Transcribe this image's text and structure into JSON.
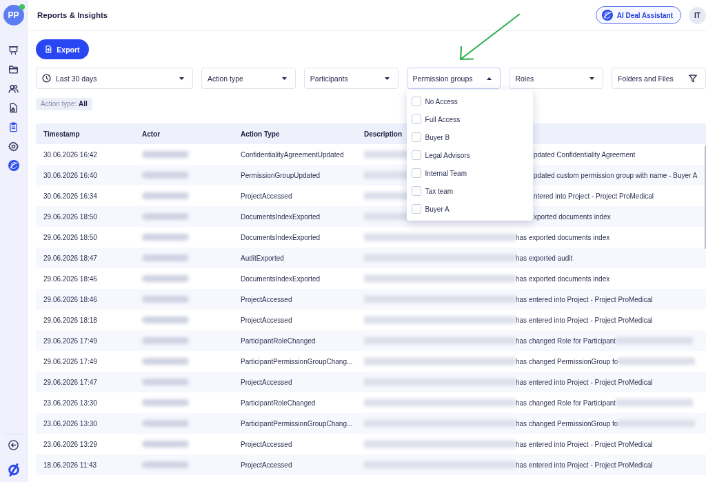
{
  "sidebar": {
    "avatar": {
      "initials": "PP",
      "online": true
    },
    "items": [
      {
        "selected": false
      },
      {
        "selected": false
      },
      {
        "selected": false
      },
      {
        "selected": false
      },
      {
        "selected": true
      },
      {
        "selected": false
      }
    ]
  },
  "header": {
    "title": "Reports & Insights",
    "assistant_button": "AI Deal Assistant",
    "user_initials": "IT"
  },
  "toolbar": {
    "export_button": "Export"
  },
  "filters": [
    {
      "kind": "date",
      "label": "Last 30 days",
      "expanded": false
    },
    {
      "kind": "select",
      "label": "Action type",
      "expanded": false
    },
    {
      "kind": "select",
      "label": "Participants",
      "expanded": false
    },
    {
      "kind": "select",
      "label": "Permission groups",
      "expanded": true,
      "options": [
        {
          "label": "No Access",
          "checked": false
        },
        {
          "label": "Full Access",
          "checked": false
        },
        {
          "label": "Buyer B",
          "checked": false
        },
        {
          "label": "Legal Advisors",
          "checked": false
        },
        {
          "label": "Internal Team",
          "checked": false
        },
        {
          "label": "Tax team",
          "checked": false
        },
        {
          "label": "Buyer A",
          "checked": false
        }
      ]
    },
    {
      "kind": "select",
      "label": "Roles",
      "expanded": false
    },
    {
      "kind": "filter",
      "label": "Folders and Files",
      "expanded": false
    }
  ],
  "active_filters": [
    {
      "text": "Action type: **All**"
    }
  ],
  "table": {
    "columns": [
      "Timestamp",
      "Actor",
      "Action Type",
      "Description"
    ],
    "rows": [
      {
        "timestamp": "30.06.2026 16:42",
        "actor": {
          "redacted": true
        },
        "action_type": "ConfidentialityAgreementUpdated",
        "description": [
          {
            "kind": "redacted"
          },
          {
            "kind": "text",
            "text": "pdated Confidentiality Agreement"
          }
        ]
      },
      {
        "timestamp": "30.06.2026 16:40",
        "actor": {
          "redacted": true
        },
        "action_type": "PermissionGroupUpdated",
        "description": [
          {
            "kind": "redacted"
          },
          {
            "kind": "text",
            "text": "pdated custom permission group with name - Buyer A"
          }
        ]
      },
      {
        "timestamp": "30.06.2026 16:34",
        "actor": {
          "redacted": true
        },
        "action_type": "ProjectAccessed",
        "description": [
          {
            "kind": "redacted"
          },
          {
            "kind": "text",
            "text": "ntered into Project - Project ProMedical"
          }
        ]
      },
      {
        "timestamp": "29.06.2026 18:50",
        "actor": {
          "redacted": true
        },
        "action_type": "DocumentsIndexExported",
        "description": [
          {
            "kind": "redacted"
          },
          {
            "kind": "text",
            "text": "xported documents index"
          }
        ]
      },
      {
        "timestamp": "29.06.2026 18:50",
        "actor": {
          "redacted": true
        },
        "action_type": "DocumentsIndexExported",
        "description": [
          {
            "kind": "redacted"
          },
          {
            "kind": "text",
            "text": "has exported documents index"
          }
        ]
      },
      {
        "timestamp": "29.06.2026 18:47",
        "actor": {
          "redacted": true
        },
        "action_type": "AuditExported",
        "description": [
          {
            "kind": "redacted"
          },
          {
            "kind": "text",
            "text": "has exported audit"
          }
        ]
      },
      {
        "timestamp": "29.06.2026 18:46",
        "actor": {
          "redacted": true
        },
        "action_type": "DocumentsIndexExported",
        "description": [
          {
            "kind": "redacted"
          },
          {
            "kind": "text",
            "text": "has exported documents index"
          }
        ]
      },
      {
        "timestamp": "29.06.2026 18:46",
        "actor": {
          "redacted": true
        },
        "action_type": "ProjectAccessed",
        "description": [
          {
            "kind": "redacted"
          },
          {
            "kind": "text",
            "text": "has entered into Project - Project ProMedical"
          }
        ]
      },
      {
        "timestamp": "29.06.2026 18:18",
        "actor": {
          "redacted": true
        },
        "action_type": "ProjectAccessed",
        "description": [
          {
            "kind": "redacted"
          },
          {
            "kind": "text",
            "text": "has entered into Project - Project ProMedical"
          }
        ]
      },
      {
        "timestamp": "29.06.2026 17:49",
        "actor": {
          "redacted": true
        },
        "action_type": "ParticipantRoleChanged",
        "description": [
          {
            "kind": "redacted"
          },
          {
            "kind": "text",
            "text": "has changed Role for Participant"
          },
          {
            "kind": "redacted"
          }
        ]
      },
      {
        "timestamp": "29.06.2026 17:49",
        "actor": {
          "redacted": true
        },
        "action_type": "ParticipantPermissionGroupChang...",
        "description": [
          {
            "kind": "redacted"
          },
          {
            "kind": "text",
            "text": "has changed PermissionGroup fo"
          },
          {
            "kind": "redacted"
          }
        ]
      },
      {
        "timestamp": "29.06.2026 17:47",
        "actor": {
          "redacted": true
        },
        "action_type": "ProjectAccessed",
        "description": [
          {
            "kind": "redacted"
          },
          {
            "kind": "text",
            "text": "has entered into Project - Project ProMedical"
          }
        ]
      },
      {
        "timestamp": "23.06.2026 13:30",
        "actor": {
          "redacted": true
        },
        "action_type": "ParticipantRoleChanged",
        "description": [
          {
            "kind": "redacted"
          },
          {
            "kind": "text",
            "text": "has changed Role for Participant"
          },
          {
            "kind": "redacted"
          }
        ]
      },
      {
        "timestamp": "23.06.2026 13:30",
        "actor": {
          "redacted": true
        },
        "action_type": "ParticipantPermissionGroupChang...",
        "description": [
          {
            "kind": "redacted"
          },
          {
            "kind": "text",
            "text": "has changed PermissionGroup fo"
          },
          {
            "kind": "redacted"
          }
        ]
      },
      {
        "timestamp": "23.06.2026 13:29",
        "actor": {
          "redacted": true
        },
        "action_type": "ProjectAccessed",
        "description": [
          {
            "kind": "redacted"
          },
          {
            "kind": "text",
            "text": "has entered into Project - Project ProMedical"
          }
        ]
      },
      {
        "timestamp": "18.06.2026 11:43",
        "actor": {
          "redacted": true
        },
        "action_type": "ProjectAccessed",
        "description": [
          {
            "kind": "redacted"
          },
          {
            "kind": "text",
            "text": "has entered into Project - Project ProMedical"
          }
        ]
      }
    ]
  }
}
